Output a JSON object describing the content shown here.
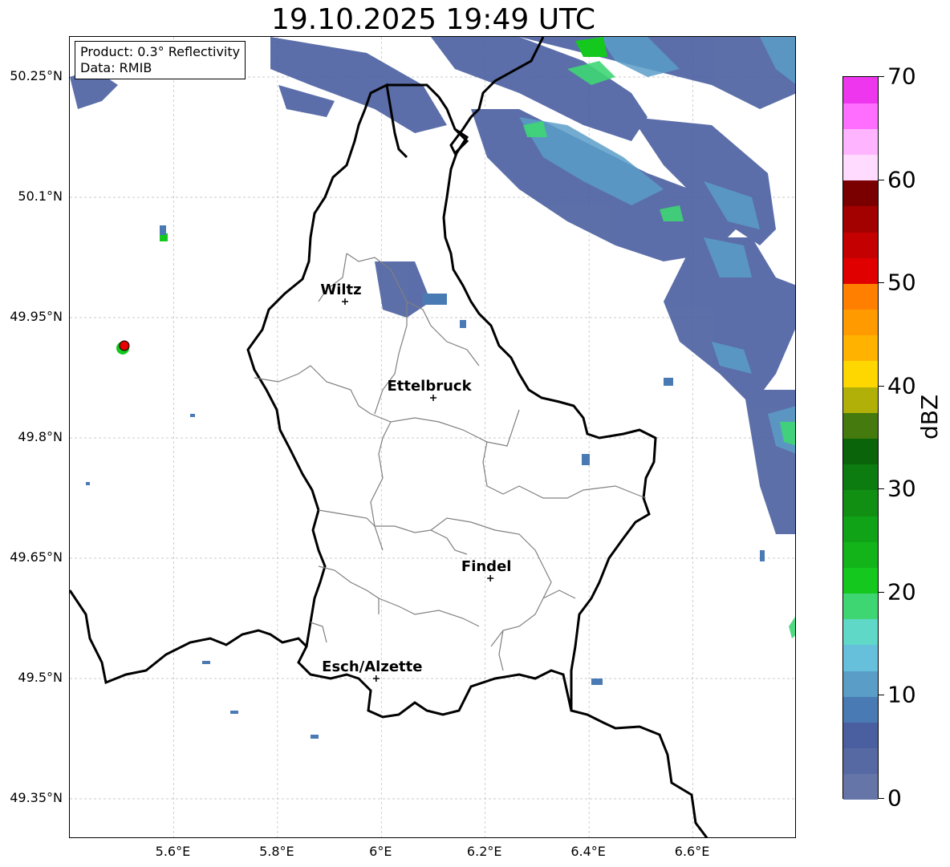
{
  "title": "19.10.2025 19:49 UTC",
  "info_box": {
    "product": "Product: 0.3° Reflectivity",
    "data": "Data: RMIB"
  },
  "lat_ticks": [
    {
      "label": "50.25°N",
      "value": 50.25
    },
    {
      "label": "50.1°N",
      "value": 50.1
    },
    {
      "label": "49.95°N",
      "value": 49.95
    },
    {
      "label": "49.8°N",
      "value": 49.8
    },
    {
      "label": "49.65°N",
      "value": 49.65
    },
    {
      "label": "49.5°N",
      "value": 49.5
    },
    {
      "label": "49.35°N",
      "value": 49.35
    }
  ],
  "lon_ticks": [
    {
      "label": "5.6°E",
      "value": 5.6
    },
    {
      "label": "5.8°E",
      "value": 5.8
    },
    {
      "label": "6°E",
      "value": 6.0
    },
    {
      "label": "6.2°E",
      "value": 6.2
    },
    {
      "label": "6.4°E",
      "value": 6.4
    },
    {
      "label": "6.6°E",
      "value": 6.6
    }
  ],
  "map_extent": {
    "lon": [
      5.4,
      6.8
    ],
    "lat": [
      49.3,
      50.3
    ]
  },
  "cities": [
    {
      "name": "Wiltz",
      "lon": 5.93,
      "lat": 49.97
    },
    {
      "name": "Ettelbruck",
      "lon": 6.1,
      "lat": 49.85
    },
    {
      "name": "Findel",
      "lon": 6.21,
      "lat": 49.625
    },
    {
      "name": "Esch/Alzette",
      "lon": 5.99,
      "lat": 49.5
    }
  ],
  "radar_site": {
    "lon": 5.505,
    "lat": 49.915,
    "color": "#e60000"
  },
  "colorbar": {
    "unit": "dBZ",
    "min": 0,
    "max": 70,
    "step": 2.5,
    "ticks": [
      {
        "label": "0",
        "value": 0
      },
      {
        "label": "10",
        "value": 10
      },
      {
        "label": "20",
        "value": 20
      },
      {
        "label": "30",
        "value": 30
      },
      {
        "label": "40",
        "value": 40
      },
      {
        "label": "50",
        "value": 50
      },
      {
        "label": "60",
        "value": 60
      },
      {
        "label": "70",
        "value": 70
      }
    ],
    "colors": [
      "#6575a8",
      "#5769a3",
      "#4a5fa0",
      "#4a7ab4",
      "#5a9ec8",
      "#66c0dc",
      "#5fd8c8",
      "#3ed673",
      "#14c81e",
      "#12b41a",
      "#11a317",
      "#108f13",
      "#0d7c10",
      "#0a6409",
      "#457a0f",
      "#b0b008",
      "#ffd700",
      "#ffb300",
      "#ff9a00",
      "#ff8000",
      "#e00000",
      "#c40000",
      "#a30000",
      "#7a0000",
      "#ffdcff",
      "#ffb4ff",
      "#ff6eff",
      "#ee36ee"
    ]
  }
}
